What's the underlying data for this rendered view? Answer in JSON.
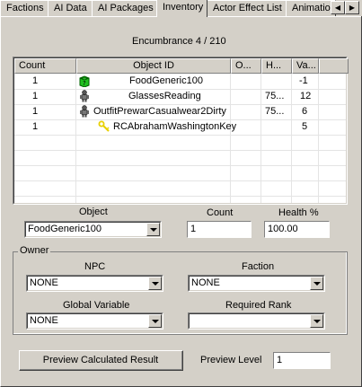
{
  "tabs": [
    {
      "label": "Factions",
      "active": false
    },
    {
      "label": "AI Data",
      "active": false
    },
    {
      "label": "AI Packages",
      "active": false
    },
    {
      "label": "Inventory",
      "active": true
    },
    {
      "label": "Actor Effect List",
      "active": false
    },
    {
      "label": "Animation",
      "active": false
    }
  ],
  "encumbrance": "Encumbrance 4 / 210",
  "inventory": {
    "columns": [
      "Count",
      "Object ID",
      "O...",
      "H...",
      "Va..."
    ],
    "rows": [
      {
        "count": "1",
        "icon": "food-box-icon",
        "object_id": "FoodGeneric100",
        "owner": "",
        "health": "",
        "value": "-1"
      },
      {
        "count": "1",
        "icon": "armor-figure-icon",
        "object_id": "GlassesReading",
        "owner": "",
        "health": "75...",
        "value": "12"
      },
      {
        "count": "1",
        "icon": "armor-figure-icon",
        "object_id": "OutfitPrewarCasualwear2Dirty",
        "owner": "",
        "health": "75...",
        "value": "6"
      },
      {
        "count": "1",
        "icon": "key-icon",
        "object_id": "RCAbrahamWashingtonKey",
        "owner": "",
        "health": "",
        "value": "5"
      }
    ]
  },
  "object": {
    "label": "Object",
    "value": "FoodGeneric100"
  },
  "count": {
    "label": "Count",
    "value": "1"
  },
  "health": {
    "label": "Health %",
    "value": "100.00"
  },
  "owner": {
    "group_label": "Owner",
    "npc": {
      "label": "NPC",
      "value": "NONE"
    },
    "faction": {
      "label": "Faction",
      "value": "NONE"
    },
    "global_variable": {
      "label": "Global Variable",
      "value": "NONE"
    },
    "required_rank": {
      "label": "Required Rank",
      "value": ""
    }
  },
  "preview_button": "Preview Calculated Result",
  "preview_level": {
    "label": "Preview Level",
    "value": "1"
  }
}
